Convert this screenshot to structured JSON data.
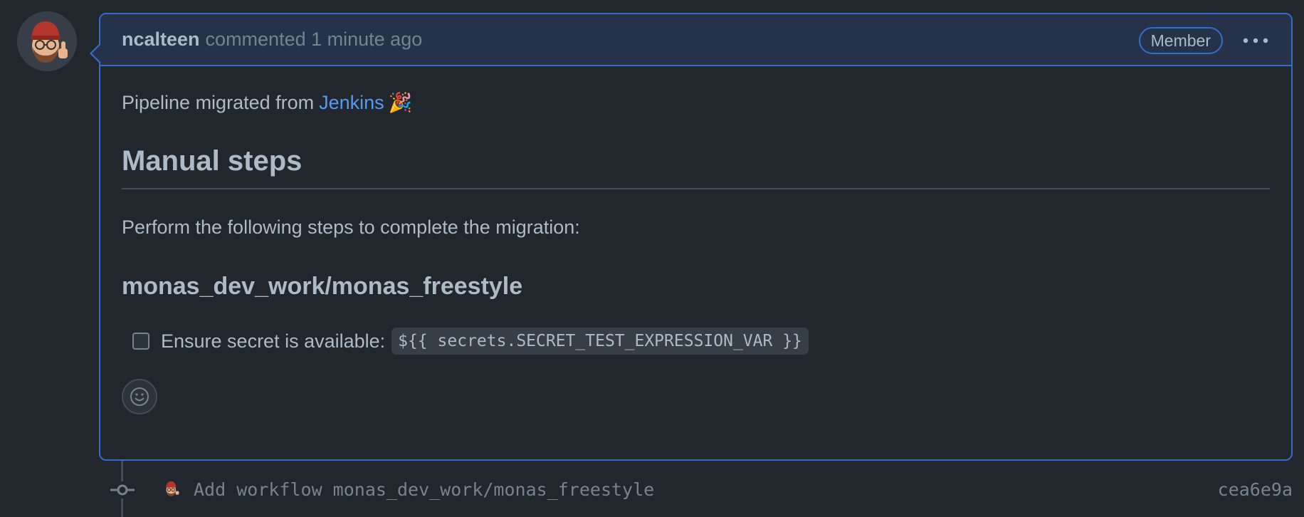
{
  "comment": {
    "author": "ncalteen",
    "meta": "commented 1 minute ago",
    "badge": "Member",
    "intro_text": "Pipeline migrated from",
    "intro_link": "Jenkins",
    "intro_emoji": "🎉",
    "heading": "Manual steps",
    "paragraph": "Perform the following steps to complete the migration:",
    "subheading": "monas_dev_work/monas_freestyle",
    "task": {
      "label": "Ensure secret is available:",
      "code": "${{ secrets.SECRET_TEST_EXPRESSION_VAR }}",
      "checked": false
    }
  },
  "timeline": {
    "commit_message": "Add workflow monas_dev_work/monas_freestyle",
    "commit_sha": "cea6e9a"
  },
  "colors": {
    "background": "#22272e",
    "header_bg": "#25324a",
    "accent_border": "#316dca",
    "link": "#539bf5",
    "text": "#adbac7",
    "muted": "#768390"
  },
  "icons": {
    "avatar": "avatar-memoji-icon",
    "kebab": "kebab-horizontal-icon",
    "reaction": "smiley-icon",
    "commit": "git-commit-icon"
  }
}
